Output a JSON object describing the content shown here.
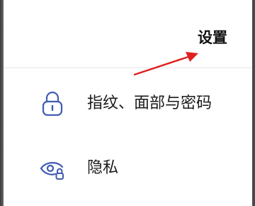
{
  "header": {
    "title": "设置"
  },
  "menu": {
    "items": [
      {
        "label": "指纹、面部与密码",
        "icon": "lock-icon"
      },
      {
        "label": "隐私",
        "icon": "privacy-eye-icon"
      }
    ]
  },
  "colors": {
    "icon_accent": "#3f5bb3",
    "arrow": "#e02020"
  }
}
